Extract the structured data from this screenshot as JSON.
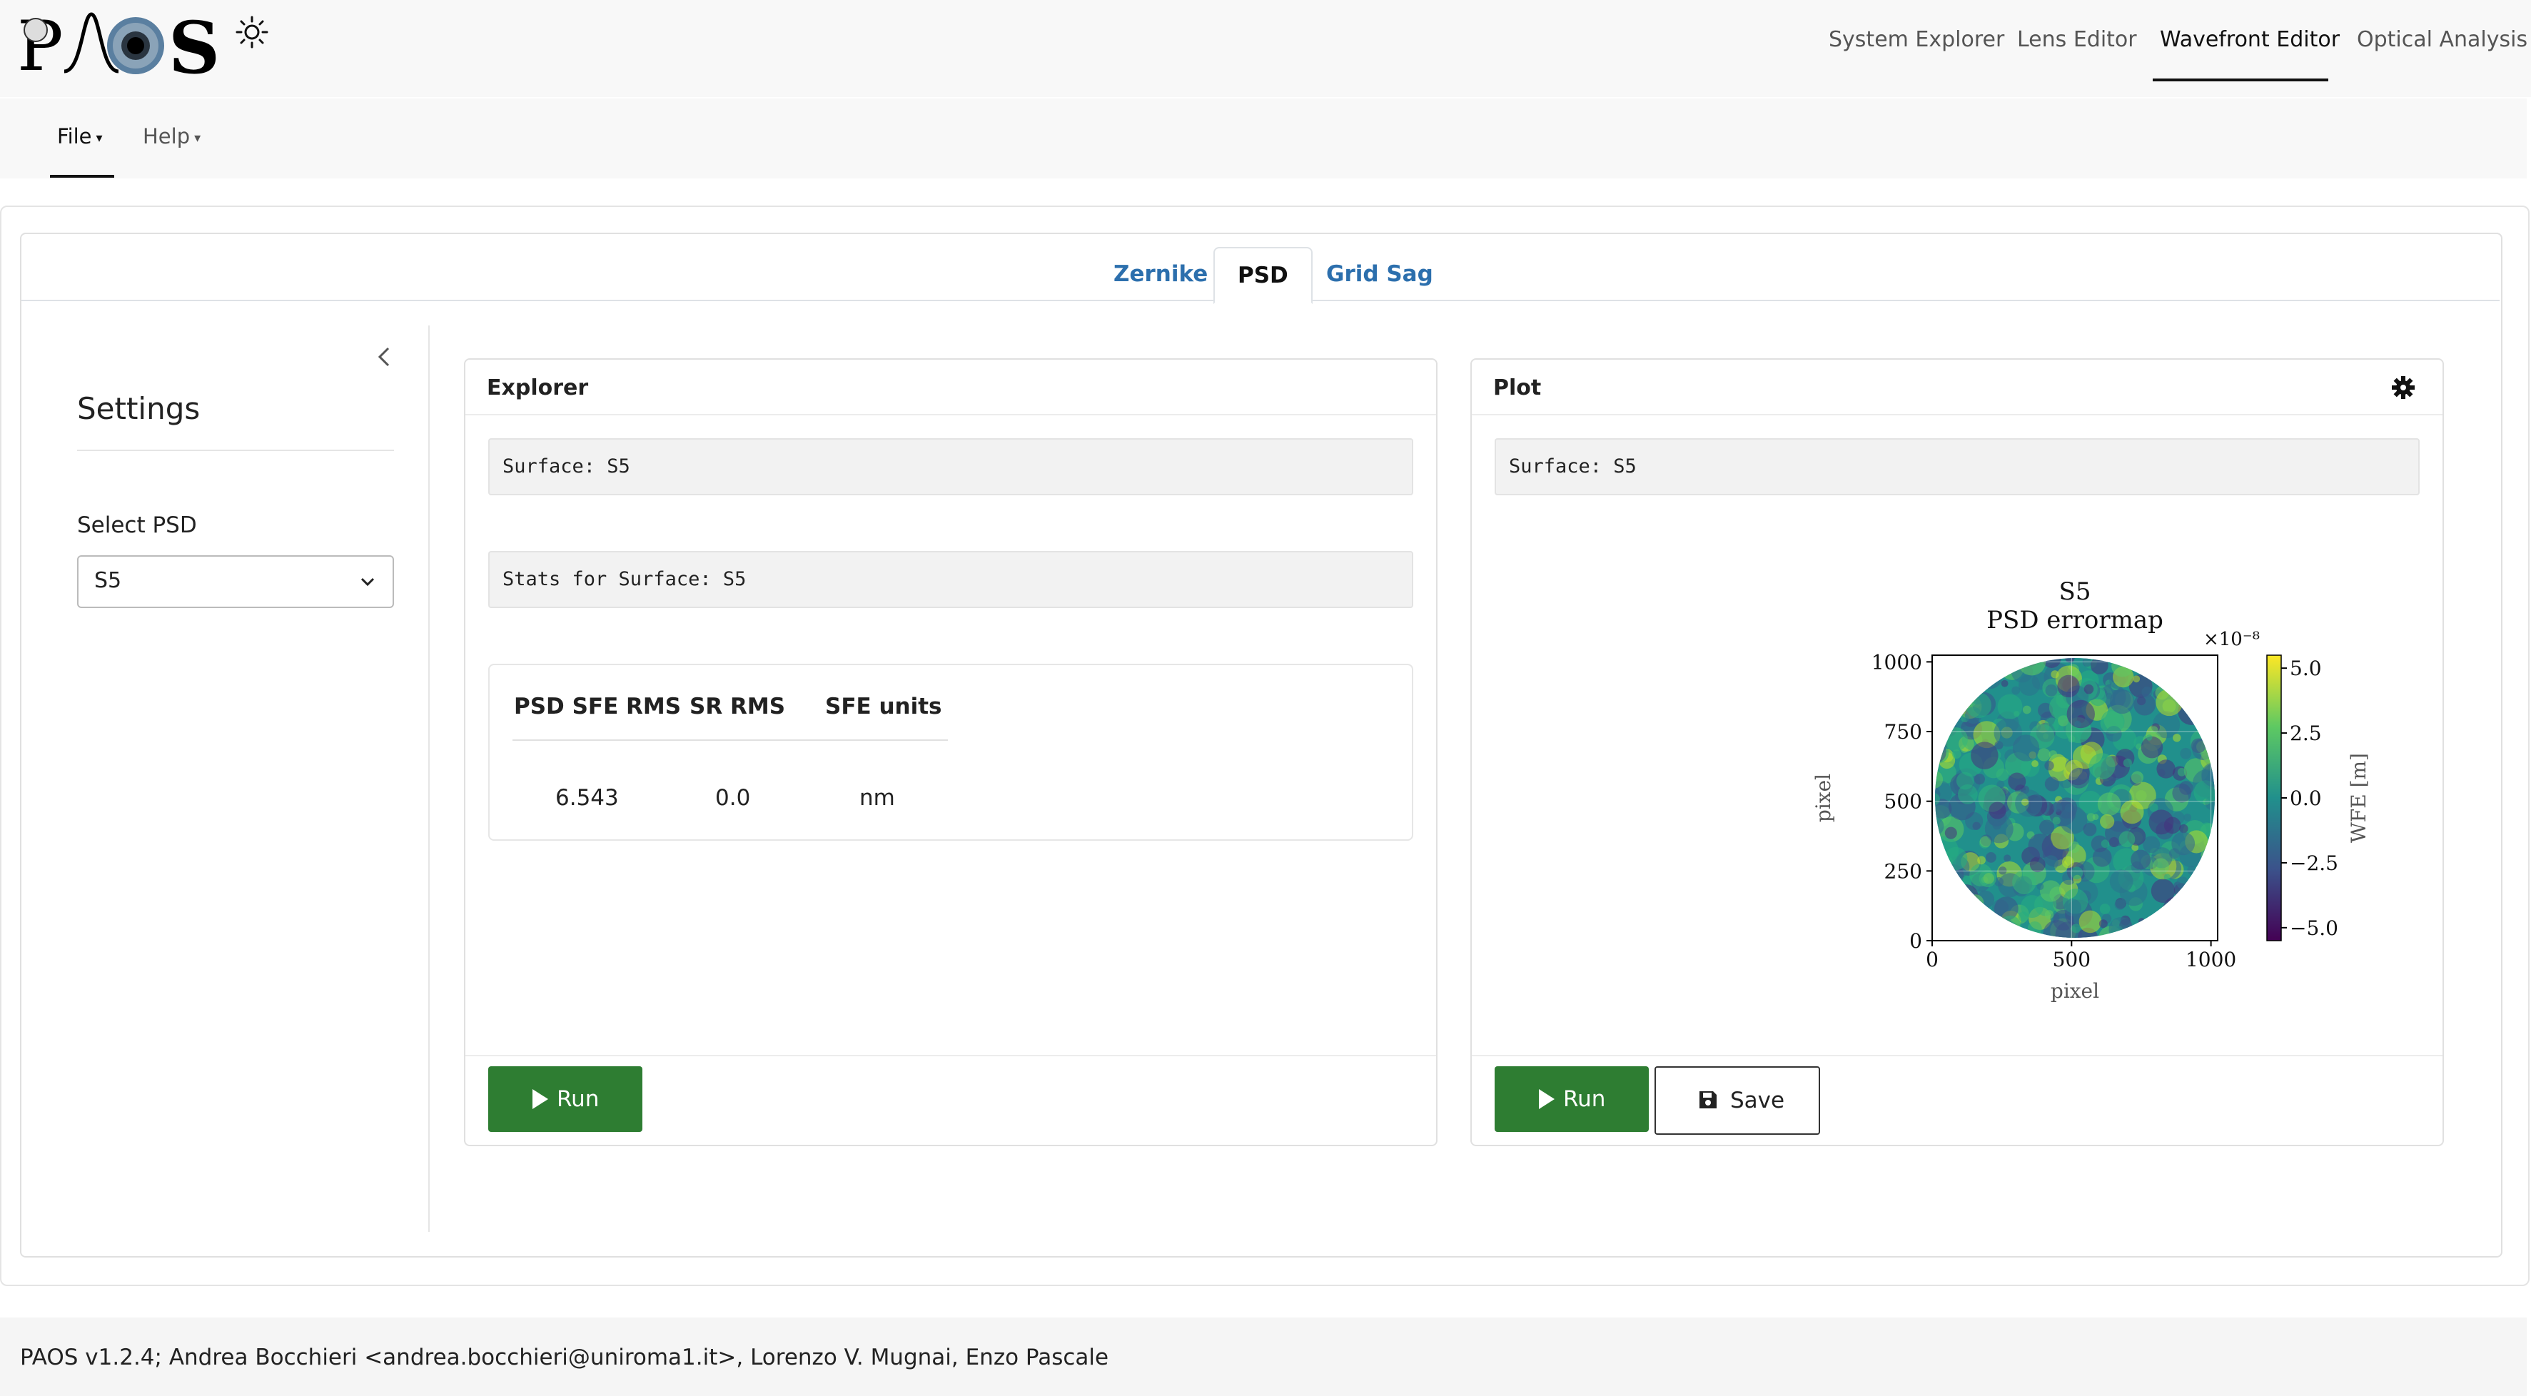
{
  "app": {
    "logo_text": "PAOS",
    "theme_icon": "sun-icon"
  },
  "topnav": {
    "items": [
      {
        "label": "System Explorer",
        "active": false
      },
      {
        "label": "Lens Editor",
        "active": false
      },
      {
        "label": "Wavefront Editor",
        "active": true
      },
      {
        "label": "Optical Analysis",
        "active": false
      }
    ]
  },
  "menubar": {
    "items": [
      {
        "label": "File",
        "active": true
      },
      {
        "label": "Help",
        "active": false
      }
    ]
  },
  "tabs": [
    {
      "label": "Zernike",
      "active": false
    },
    {
      "label": "PSD",
      "active": true
    },
    {
      "label": "Grid Sag",
      "active": false
    }
  ],
  "settings": {
    "title": "Settings",
    "select_label": "Select PSD",
    "select_value": "S5"
  },
  "explorer": {
    "title": "Explorer",
    "surface_text": "Surface: S5",
    "stats_text": "Stats for Surface: S5",
    "table": {
      "headers": [
        "PSD SFE RMS",
        "SR RMS",
        "SFE units"
      ],
      "rows": [
        [
          "6.543",
          "0.0",
          "nm"
        ]
      ]
    },
    "run_label": "Run"
  },
  "plot": {
    "title": "Plot",
    "surface_text": "Surface: S5",
    "run_label": "Run",
    "save_label": "Save"
  },
  "chart_data": {
    "type": "heatmap",
    "title": "S5",
    "subtitle": "PSD errormap",
    "xlabel": "pixel",
    "ylabel": "pixel",
    "xlim": [
      0,
      1024
    ],
    "ylim": [
      0,
      1024
    ],
    "xticks": [
      "0",
      "500",
      "1000"
    ],
    "yticks": [
      "0",
      "250",
      "500",
      "750",
      "1000"
    ],
    "colorbar": {
      "label": "WFE [m]",
      "scale_label": "×10⁻⁸",
      "ticks": [
        "5.0",
        "2.5",
        "0.0",
        "−2.5",
        "−5.0"
      ],
      "range": [
        -5.5,
        5.5
      ],
      "colormap": "viridis"
    },
    "aperture": "circular",
    "grid": true
  },
  "footer": {
    "text": "PAOS v1.2.4; Andrea Bocchieri <andrea.bocchieri@uniroma1.it>, Lorenzo V. Mugnai, Enzo Pascale"
  },
  "colors": {
    "run_button": "#2e7d32",
    "tab_link": "#2c6fad",
    "nav_bg": "#f8f8f8"
  }
}
